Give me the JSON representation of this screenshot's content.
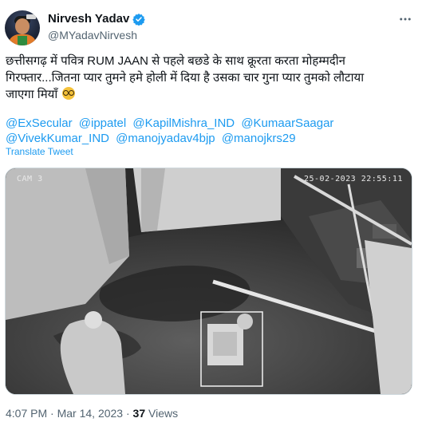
{
  "author": {
    "name": "Nirvesh Yadav",
    "handle": "@MYadavNirvesh",
    "verified_icon": "verified-badge-icon",
    "accent": "#1d9bf0"
  },
  "tweet": {
    "text_line1": "छत्तीसगढ़ में पवित्र RUM JAAN से पहले बछडे के साथ क्रूरता करता मोहम्मदीन",
    "text_line2": "गिरफ्तार...जितना प्यार तुमने हमे होली में दिया है उसका चार गुना प्यार तुमको लौटाया",
    "text_line3": "जाएगा मियाँ",
    "emoji_name": "nerd-face-emoji",
    "mentions": [
      "@ExSecular",
      "@ippatel",
      "@KapilMishra_IND",
      "@KumaarSaagar",
      "@VivekKumar_IND",
      "@manojyadav4bjp",
      "@manojkrs29"
    ],
    "translate_label": "Translate Tweet"
  },
  "media": {
    "camera_label": "CAM 3",
    "timestamp": "25-02-2023 22:55:11"
  },
  "meta": {
    "time": "4:07 PM",
    "separator": "·",
    "date": "Mar 14, 2023",
    "views_count": "37",
    "views_label": "Views"
  },
  "more_icon": "more-horizontal-icon"
}
